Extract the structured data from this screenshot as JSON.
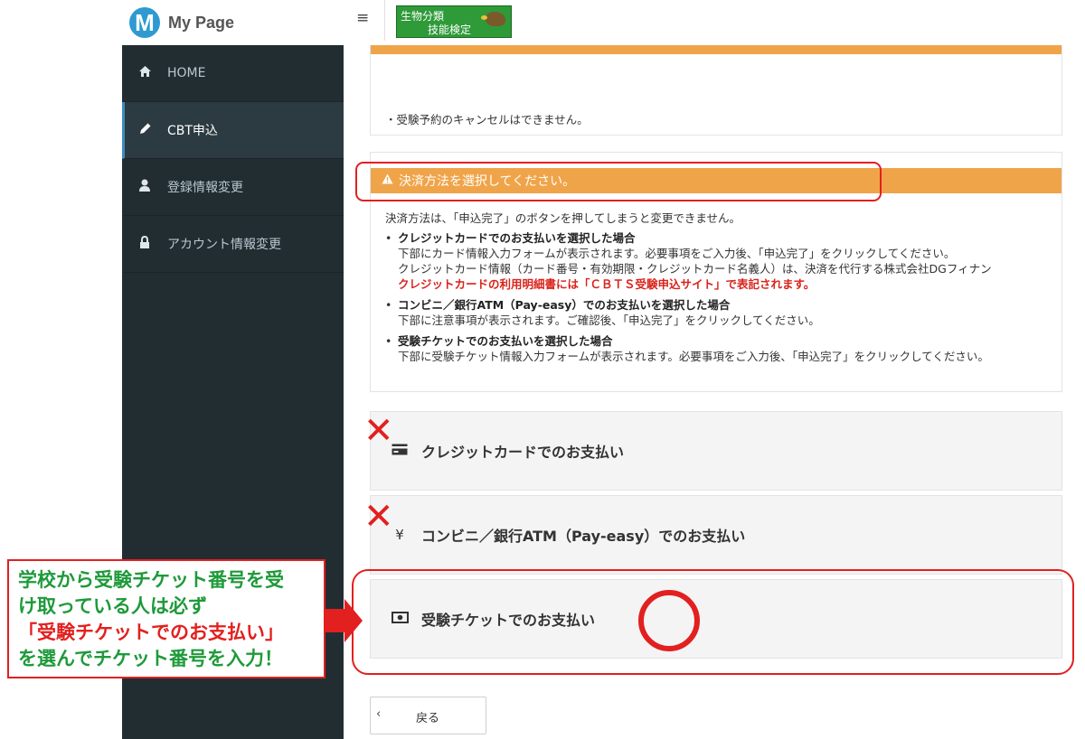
{
  "brand": {
    "logo_letter": "M",
    "title": "My Page",
    "brand_color": "#2e9ad0"
  },
  "topbar": {
    "menu_icon": "≡",
    "badge": {
      "line1": "生物分類",
      "line2": "技能検定",
      "color": "#2e9a38"
    }
  },
  "sidebar": {
    "items": [
      {
        "label": "HOME",
        "icon": "home-icon",
        "active": false
      },
      {
        "label": "CBT申込",
        "icon": "pencil-icon",
        "active": true
      },
      {
        "label": "登録情報変更",
        "icon": "user-icon",
        "active": false
      },
      {
        "label": "アカウント情報変更",
        "icon": "lock-icon",
        "active": false
      }
    ]
  },
  "notice": {
    "text": "・受験予約のキャンセルはできません。"
  },
  "payment_info": {
    "warning": "決済方法を選択してください。",
    "lead": "決済方法は、「申込完了」のボタンを押してしまうと変更できません。",
    "items": [
      {
        "title": "クレジットカードでのお支払いを選択した場合",
        "line1": "下部にカード情報入力フォームが表示されます。必要事項をご入力後、「申込完了」をクリックしてください。",
        "line2": "クレジットカード情報（カード番号・有効期限・クレジットカード名義人）は、決済を代行する株式会社DGフィナン",
        "line3": "クレジットカードの利用明細書には「ＣＢＴＳ受験申込サイト」で表記されます。"
      },
      {
        "title": "コンビニ／銀行ATM（Pay-easy）でのお支払いを選択した場合",
        "line1": "下部に注意事項が表示されます。ご確認後、「申込完了」をクリックしてください。"
      },
      {
        "title": "受験チケットでのお支払いを選択した場合",
        "line1": "下部に受験チケット情報入力フォームが表示されます。必要事項をご入力後、「申込完了」をクリックしてください。"
      }
    ]
  },
  "payment_options": [
    {
      "label": "クレジットカードでのお支払い",
      "icon": "credit-card-icon"
    },
    {
      "label": "コンビニ／銀行ATM（Pay-easy）でのお支払い",
      "icon": "yen-icon"
    },
    {
      "label": "受験チケットでのお支払い",
      "icon": "money-icon"
    }
  ],
  "back_button": {
    "label": "戻る"
  },
  "annotation": {
    "line1": "学校から受験チケット番号を受",
    "line2": "け取っている人は必ず",
    "line3": "「受験チケットでのお支払い」",
    "line4": "を選んでチケット番号を入力！",
    "cross_mark": "✕",
    "accent_color": "#e2201f",
    "text_color": "#1e9a3a"
  }
}
